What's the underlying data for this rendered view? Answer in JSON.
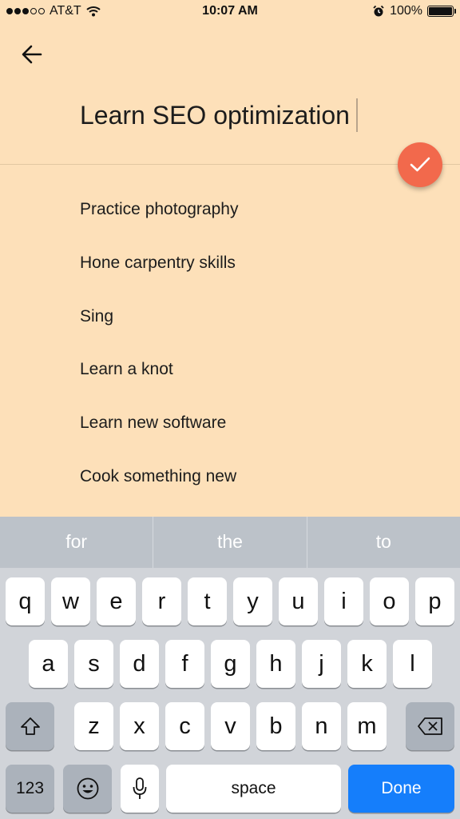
{
  "status_bar": {
    "carrier": "AT&T",
    "time": "10:07 AM",
    "battery": "100%",
    "signal_bars_filled": 3,
    "signal_bars_total": 5
  },
  "header": {
    "title_value": "Learn SEO optimization"
  },
  "suggestions": [
    "Practice photography",
    "Hone carpentry skills",
    "Sing",
    "Learn a knot",
    "Learn new software",
    "Cook something new"
  ],
  "keyboard": {
    "predictions": [
      "for",
      "the",
      "to"
    ],
    "row1": [
      "q",
      "w",
      "e",
      "r",
      "t",
      "y",
      "u",
      "i",
      "o",
      "p"
    ],
    "row2": [
      "a",
      "s",
      "d",
      "f",
      "g",
      "h",
      "j",
      "k",
      "l"
    ],
    "row3": [
      "z",
      "x",
      "c",
      "v",
      "b",
      "n",
      "m"
    ],
    "numbers_label": "123",
    "space_label": "space",
    "done_label": "Done"
  },
  "colors": {
    "background": "#fde0b9",
    "fab": "#f2694c",
    "done_key": "#157efb"
  }
}
